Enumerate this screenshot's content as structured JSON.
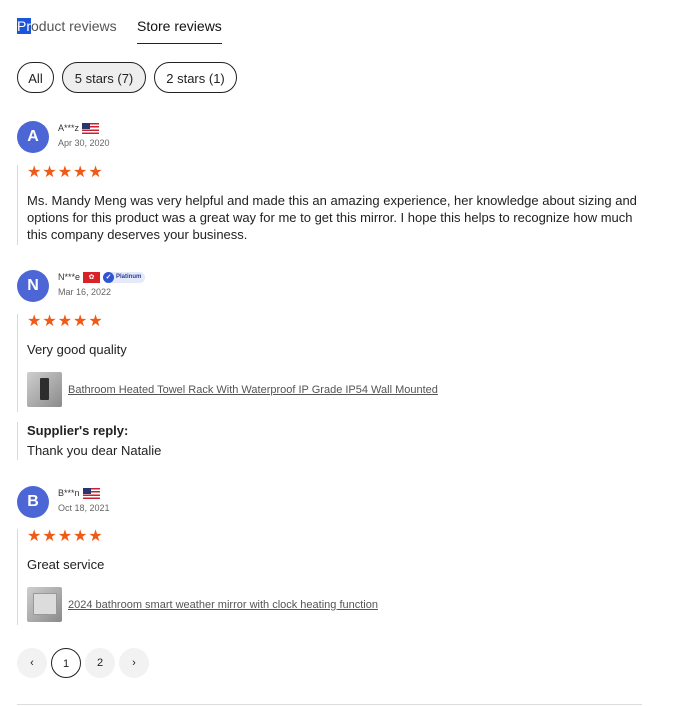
{
  "tabs": {
    "product_prefix": "Pr",
    "product_rest": "oduct reviews",
    "store": "Store reviews"
  },
  "filters": [
    {
      "label": "All"
    },
    {
      "label": "5 stars (7)"
    },
    {
      "label": "2 stars (1)"
    }
  ],
  "reviews": [
    {
      "initial": "A",
      "name": "A***z",
      "date": "Apr 30, 2020",
      "rating": 5,
      "text": "Ms. Mandy Meng was very helpful and made this an amazing experience, her knowledge about sizing and options for this product was a great way for me to get this mirror. I hope this helps to recognize how much this company deserves your business."
    },
    {
      "initial": "N",
      "name": "N***e",
      "badge": "Platinum",
      "date": "Mar 16, 2022",
      "rating": 5,
      "text": "Very good quality",
      "product": "Bathroom Heated Towel Rack With Waterproof IP Grade IP54 Wall Mounted",
      "reply_title": "Supplier's reply:",
      "reply_text": "Thank you dear Natalie"
    },
    {
      "initial": "B",
      "name": "B***n",
      "date": "Oct 18, 2021",
      "rating": 5,
      "text": "Great service",
      "product": "2024 bathroom smart weather mirror with clock heating function"
    }
  ],
  "stars_glyph": "★★★★★",
  "pagination": {
    "prev": "‹",
    "pages": [
      "1",
      "2"
    ],
    "next": "›"
  },
  "colors": {
    "accent": "#f05a16",
    "avatar": "#4c66d6"
  }
}
